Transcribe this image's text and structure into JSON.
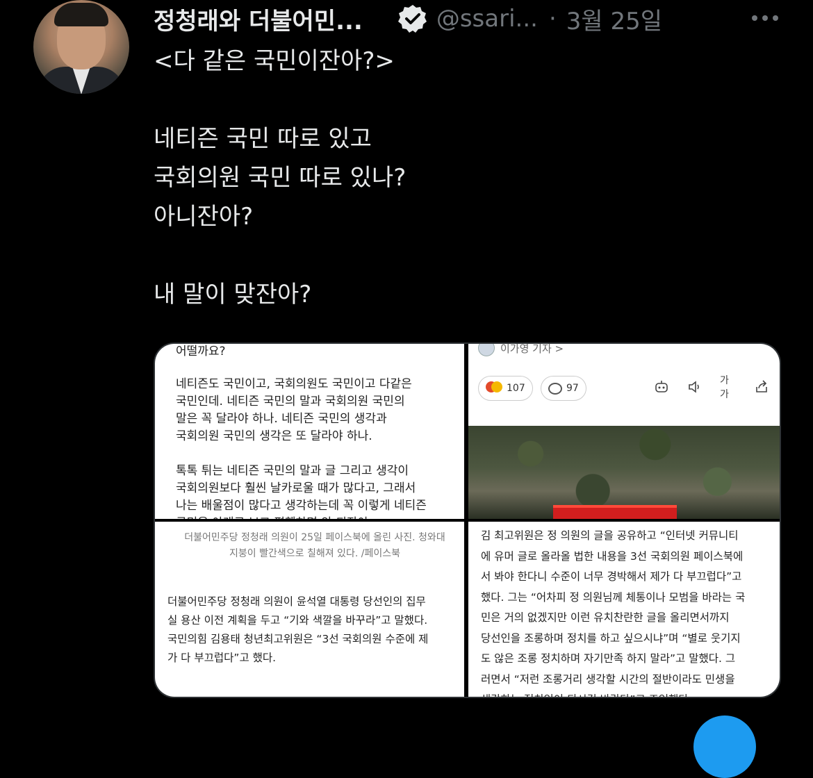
{
  "tweet": {
    "display_name": "정청래와 더불어민...",
    "handle": "@ssari...",
    "separator": "·",
    "date": "3월 25일",
    "text": "<다 같은 국민이잔아?>\n\n네티즌 국민 따로 있고\n국회의원 국민 따로 있나?\n아니잔아?\n\n내 말이 맞잔아?"
  },
  "media": {
    "q1": {
      "top_line": "어떨까요?",
      "text": "네티즌도 국민이고, 국회의원도 국민이고 다같은\n국민인데. 네티즌 국민의 말과 국회의원 국민의\n말은 꼭 달라야 하나. 네티즌 국민의 생각과\n국회의원 국민의 생각은 또 달라야 하나.\n\n톡톡 튀는 네티즌 국민의 말과 글 그리고 생각이\n국회의원보다 훨씬 날카로울 때가 많다고, 그래서\n나는 배울점이 많다고 생각하는데 꼭 이렇게 네티즌\n국민을 아래로 보고 폄훼하면 안 되잔아"
    },
    "q2": {
      "reporter": "이가영 기자 >",
      "reaction_count": "107",
      "comment_count": "97",
      "font_size_label": "가가"
    },
    "q3": {
      "caption": "더불어민주당 정청래 의원이 25일 페이스북에 올린 사진. 청와대\n지붕이 빨간색으로 칠해져 있다. /페이스북",
      "text": "더불어민주당 정청래 의원이 윤석열 대통령 당선인의 집무\n실 용산 이전 계획을 두고 “기와 색깔을 바꾸라”고 말했다.\n국민의힘 김용태 청년최고위원은 “3선 국회의원 수준에 제\n가 다 부끄럽다”고 했다."
    },
    "q4": {
      "text": "김 최고위원은 정 의원의 글을 공유하고 “인터넷 커뮤니티\n에 유머 글로 올라올 법한 내용을 3선 국회의원 페이스북에\n서 봐야 한다니 수준이 너무 경박해서 제가 다 부끄럽다”고\n했다. 그는 “어차피 정 의원님께 체통이나 모범을 바라는 국\n민은 거의 없겠지만 이런 유치찬란한 글을 올리면서까지\n당선인을 조롱하며 정치를 하고 싶으시냐”며 “별로 웃기지\n도 않은 조롱 정치하며 자기만족 하지 말라”고 말했다. 그\n러면서 “저런 조롱거리 생각할 시간의 절반이라도 민생을\n생각하는 정치인이 되시길 바란다”고 조언했다."
    }
  },
  "colors": {
    "background": "#000000",
    "text": "#e7e9ea",
    "muted": "#71767b",
    "accent": "#1d9bf0",
    "roof_red": "#d21e1e"
  },
  "icons": [
    "verified-badge-icon",
    "more-icon",
    "reaction-emoji-icon",
    "comment-icon",
    "robot-icon",
    "speaker-icon",
    "share-icon"
  ]
}
